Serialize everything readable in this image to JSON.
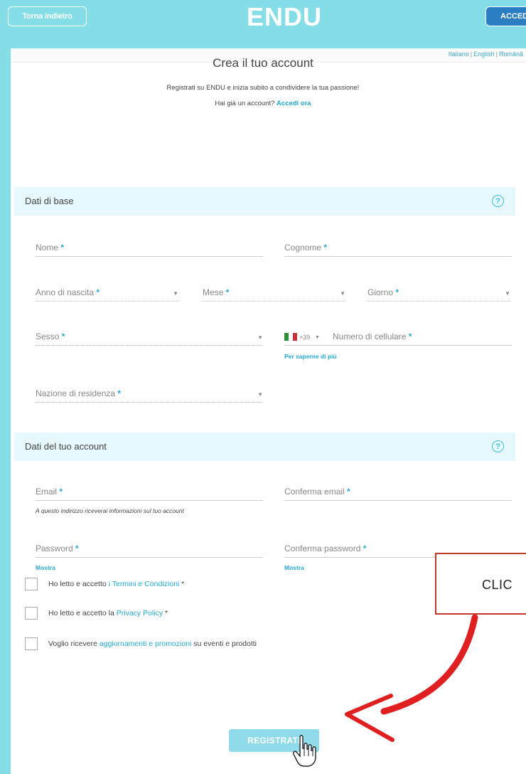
{
  "header": {
    "back_label": "Torna indietro",
    "logo": "ENDU",
    "login_label": "ACCED"
  },
  "languages": [
    "Italiano",
    "English",
    "Română"
  ],
  "page": {
    "title": "Crea il tuo account",
    "subtitle": "Registrati su ENDU e inizia subito a condividere la tua passione!",
    "have_account": "Hai già un account?",
    "login_link": "Accedi ora"
  },
  "sections": {
    "basic": "Dati di base",
    "account": "Dati del tuo account",
    "help_symbol": "?"
  },
  "fields": {
    "nome": "Nome",
    "cognome": "Cognome",
    "anno": "Anno di nascita",
    "mese": "Mese",
    "giorno": "Giorno",
    "sesso": "Sesso",
    "country_code": "+39",
    "cellulare": "Numero di cellulare",
    "phone_info_link": "Per saperne di più",
    "nazione": "Nazione di residenza",
    "email": "Email",
    "email_hint": "A questo indirizzo riceverai informazioni sul tuo account",
    "conferma_email": "Conferma email",
    "password": "Password",
    "conferma_password": "Conferma password",
    "show_label": "Mostra",
    "required_mark": "*"
  },
  "checkboxes": [
    {
      "prefix": "Ho letto e accetto",
      "link": "i Termini e Condizioni",
      "suffix": "*",
      "checked": false
    },
    {
      "prefix": "Ho letto e accetto la",
      "link": "Privacy Policy",
      "suffix": "*",
      "checked": false
    },
    {
      "prefix": "Voglio ricevere",
      "link": "aggiornamenti e promozioni",
      "suffix": "su eventi e prodotti",
      "checked": false
    }
  ],
  "submit_label": "REGISTRATI",
  "annotation": {
    "callout_text": "CLIC",
    "color": "#c0392b"
  },
  "colors": {
    "accent": "#85dde8",
    "link": "#25a9cf",
    "login_button": "#2a7ec1",
    "section_bg": "#e6f8fb"
  }
}
